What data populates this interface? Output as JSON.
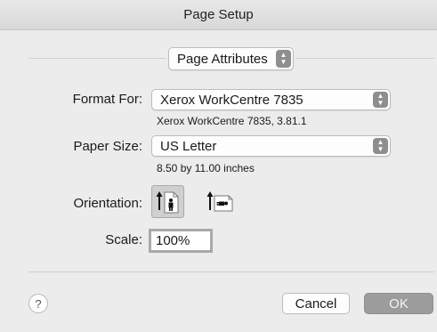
{
  "window": {
    "title": "Page Setup"
  },
  "settings_popup": {
    "value": "Page Attributes"
  },
  "format_for": {
    "label": "Format For:",
    "value": "Xerox WorkCentre 7835",
    "detail": "Xerox WorkCentre 7835, 3.81.1"
  },
  "paper_size": {
    "label": "Paper Size:",
    "value": "US Letter",
    "detail": "8.50 by 11.00 inches"
  },
  "orientation": {
    "label": "Orientation:",
    "options": [
      {
        "icon": "portrait-orientation-icon",
        "selected": true
      },
      {
        "icon": "landscape-orientation-icon",
        "selected": false
      }
    ]
  },
  "scale": {
    "label": "Scale:",
    "value": "100%"
  },
  "buttons": {
    "help": "?",
    "cancel": "Cancel",
    "ok": "OK"
  },
  "colors": {
    "background": "#ececec",
    "selected_orientation": "#cfcfcf",
    "ok_button": "#9c9c9c"
  }
}
